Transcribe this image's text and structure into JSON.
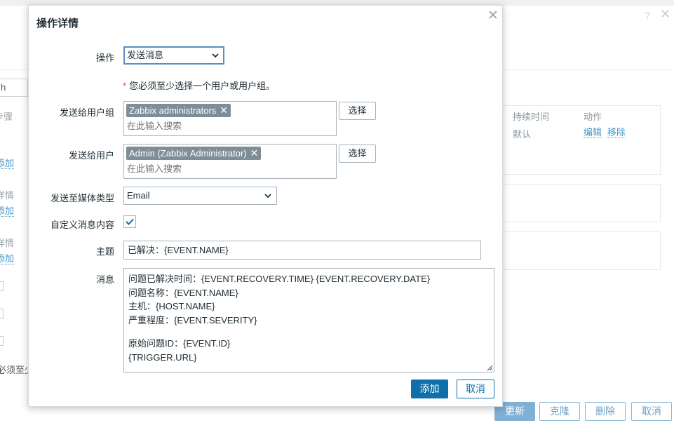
{
  "background": {
    "search_value": "h",
    "left_labels": [
      "步骤",
      "添加",
      "详情",
      "添加",
      "详情",
      "添加",
      "必须至少"
    ],
    "table_headers": {
      "duration": "持续时间",
      "action": "动作"
    },
    "row_default": "默认",
    "edit_link": "编辑",
    "remove_link": "移除",
    "buttons": {
      "update": "更新",
      "clone": "克隆",
      "delete": "删除",
      "cancel": "取消"
    }
  },
  "modal": {
    "title": "操作详情",
    "close_icon": "close-icon",
    "operation": {
      "label": "操作",
      "value": "发送消息"
    },
    "required_hint": {
      "star": "*",
      "text": "您必须至少选择一个用户或用户组。"
    },
    "send_to_groups": {
      "label": "发送给用户组",
      "chips": [
        "Zabbix administrators"
      ],
      "placeholder": "在此输入搜索",
      "select_button": "选择"
    },
    "send_to_users": {
      "label": "发送给用户",
      "chips": [
        "Admin (Zabbix Administrator)"
      ],
      "placeholder": "在此输入搜索",
      "select_button": "选择"
    },
    "media_type": {
      "label": "发送至媒体类型",
      "value": "Email"
    },
    "custom_message": {
      "label": "自定义消息内容",
      "checked": true
    },
    "subject": {
      "label": "主题",
      "value": "已解决：{EVENT.NAME}"
    },
    "message": {
      "label": "消息",
      "lines": [
        "问题已解决时间：{EVENT.RECOVERY.TIME} {EVENT.RECOVERY.DATE}",
        "问题名称：{EVENT.NAME}",
        "主机：{HOST.NAME}",
        "严重程度：{EVENT.SEVERITY}",
        "",
        "原始问题ID：{EVENT.ID}",
        "{TRIGGER.URL}"
      ]
    },
    "buttons": {
      "add": "添加",
      "cancel": "取消"
    }
  },
  "colors": {
    "primary": "#0e6faa",
    "chip_bg": "#7e8d97",
    "required_star": "#d8474e",
    "link": "#4796c4"
  }
}
